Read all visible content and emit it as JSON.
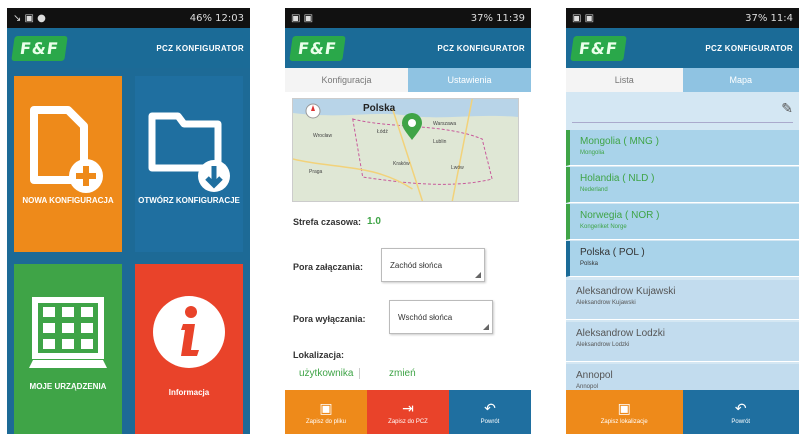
{
  "colors": {
    "orange": "#ee8a1a",
    "blue": "#1f6fa0",
    "green": "#3fa447",
    "red": "#e9432a",
    "appbar": "#1b6b97"
  },
  "logo": "F&F",
  "app_title": "PCZ KONFIGURATOR",
  "screen1": {
    "status_left": "↘ ▣ ●",
    "status_right": "46% 12:03",
    "tiles": [
      {
        "label": "NOWA KONFIGURACJA",
        "icon": "new-file-icon"
      },
      {
        "label": "OTWÓRZ KONFIGURACJE",
        "icon": "open-folder-icon"
      },
      {
        "label": "MOJE URZĄDZENIA",
        "icon": "device-grid-icon"
      },
      {
        "label": "Informacja",
        "icon": "info-icon"
      }
    ]
  },
  "screen2": {
    "status_left": "▣ ▣",
    "status_right": "37% 11:39",
    "tabs": [
      "Konfiguracja",
      "Ustawienia"
    ],
    "map": {
      "country": "Polska",
      "cities": [
        "Gdańsk",
        "Wrocław",
        "Łódź",
        "Kraków",
        "Lublin",
        "Warszawa",
        "Lwów",
        "Praga"
      ],
      "icon": "map-pin-icon"
    },
    "timezone_label": "Strefa czasowa:",
    "timezone_value": "1.0",
    "on_label": "Pora załączania:",
    "on_value": "Zachód słońca",
    "off_label": "Pora wyłączania:",
    "off_value": "Wschód słońca",
    "location_label": "Lokalizacja:",
    "location_value": "użytkownika",
    "change_label": "zmień",
    "bottom": [
      {
        "label": "Zapisz do pliku",
        "icon": "save-icon",
        "color": "#ee8a1a"
      },
      {
        "label": "Zapisz do PCZ",
        "icon": "export-icon",
        "color": "#e9432a"
      },
      {
        "label": "Powrót",
        "icon": "back-icon",
        "color": "#1f6fa0"
      }
    ]
  },
  "screen3": {
    "status_left": "▣ ▣",
    "status_right": "37% 11:4",
    "tabs": [
      "Lista",
      "Mapa"
    ],
    "items": [
      {
        "name": "Mongolia ( MNG )",
        "sub": "Mongolia",
        "style": "green"
      },
      {
        "name": "Holandia ( NLD )",
        "sub": "Nederland",
        "style": "green"
      },
      {
        "name": "Norwegia ( NOR )",
        "sub": "Kongeriket Norge",
        "style": "green"
      },
      {
        "name": "Polska ( POL )",
        "sub": "Polska",
        "style": "sel"
      },
      {
        "name": "Aleksandrow Kujawski",
        "sub": "Aleksandrow Kujawski",
        "style": "gray"
      },
      {
        "name": "Aleksandrow Lodzki",
        "sub": "Aleksandrow Lodzki",
        "style": "gray"
      },
      {
        "name": "Annopol",
        "sub": "Annopol",
        "style": "gray"
      }
    ],
    "bottom": [
      {
        "label": "Zapisz lokalizacje",
        "icon": "save-icon",
        "color": "#ee8a1a"
      },
      {
        "label": "Powrót",
        "icon": "back-icon",
        "color": "#1f6fa0"
      }
    ]
  }
}
